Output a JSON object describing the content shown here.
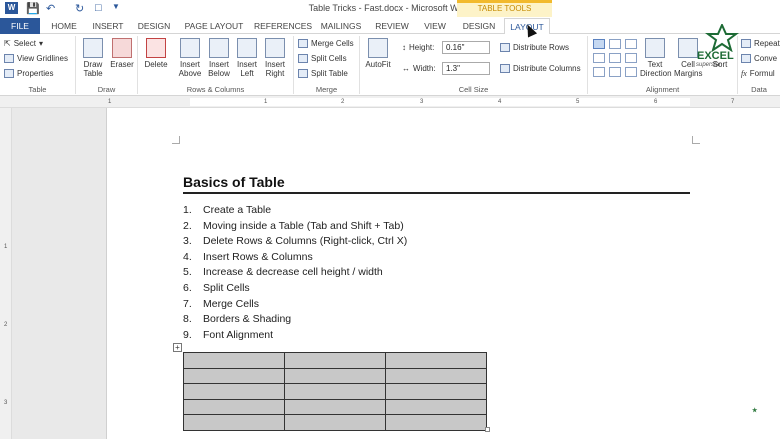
{
  "window": {
    "title": "Table Tricks - Fast.docx - Microsoft Word",
    "context_label": "TABLE TOOLS"
  },
  "tabs": [
    {
      "label": "FILE"
    },
    {
      "label": "HOME"
    },
    {
      "label": "INSERT"
    },
    {
      "label": "DESIGN"
    },
    {
      "label": "PAGE LAYOUT"
    },
    {
      "label": "REFERENCES"
    },
    {
      "label": "MAILINGS"
    },
    {
      "label": "REVIEW"
    },
    {
      "label": "VIEW"
    },
    {
      "label": "DESIGN"
    },
    {
      "label": "LAYOUT"
    }
  ],
  "ribbon": {
    "table": {
      "label": "Table",
      "select": "Select",
      "gridlines": "View Gridlines",
      "properties": "Properties"
    },
    "draw": {
      "label": "Draw",
      "draw_table": "Draw Table",
      "eraser": "Eraser"
    },
    "rows_columns": {
      "label": "Rows & Columns",
      "delete": "Delete",
      "insert_above": "Insert Above",
      "insert_below": "Insert Below",
      "insert_left": "Insert Left",
      "insert_right": "Insert Right"
    },
    "merge": {
      "label": "Merge",
      "merge_cells": "Merge Cells",
      "split_cells": "Split Cells",
      "split_table": "Split Table"
    },
    "cell_size": {
      "label": "Cell Size",
      "autofit": "AutoFit",
      "height_label": "Height:",
      "height_value": "0.16\"",
      "width_label": "Width:",
      "width_value": "1.3\"",
      "distribute_rows": "Distribute Rows",
      "distribute_columns": "Distribute Columns"
    },
    "alignment": {
      "label": "Alignment",
      "text_direction": "Text Direction",
      "cell_margins": "Cell Margins",
      "sort": "Sort"
    },
    "data": {
      "label": "Data",
      "repeat": "Repeat",
      "convert": "Conve",
      "formula": "Formul"
    }
  },
  "ruler": {
    "h_numbers": [
      "1",
      "1",
      "2",
      "3",
      "4",
      "5",
      "6",
      "7"
    ],
    "v_numbers": [
      "1",
      "2",
      "3"
    ]
  },
  "document": {
    "heading": "Basics of Table",
    "items": [
      {
        "num": "1.",
        "text": "Create a Table"
      },
      {
        "num": "2.",
        "text": "Moving inside a Table (Tab and Shift + Tab)"
      },
      {
        "num": "3.",
        "text": "Delete Rows & Columns (Right-click, Ctrl X)"
      },
      {
        "num": "4.",
        "text": "Insert Rows & Columns"
      },
      {
        "num": "5.",
        "text": "Increase & decrease cell height / width"
      },
      {
        "num": "6.",
        "text": "Split Cells"
      },
      {
        "num": "7.",
        "text": "Merge Cells"
      },
      {
        "num": "8.",
        "text": "Borders & Shading"
      },
      {
        "num": "9.",
        "text": "Font Alignment"
      }
    ],
    "table": {
      "rows": 5,
      "cols": 3
    }
  },
  "branding": {
    "logo_line1": "EXCEL",
    "logo_line2": "superstar"
  },
  "colors": {
    "accent": "#2b579a",
    "context_tab": "#f2ba2d",
    "table_fill": "#c8c8c8"
  }
}
